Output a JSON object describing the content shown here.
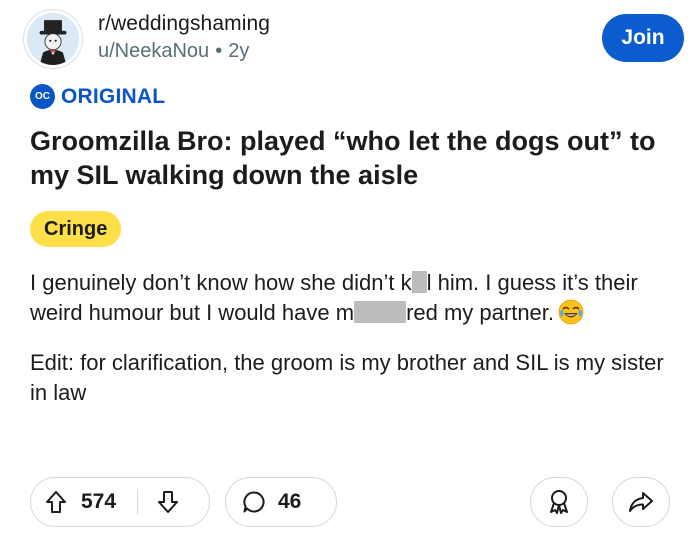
{
  "post": {
    "subreddit": "r/weddingshaming",
    "author": "u/NeekaNou",
    "separator": "•",
    "age": "2y",
    "join_label": "Join",
    "oc_badge": "OC",
    "oc_label": "ORIGINAL",
    "title": "Groomzilla Bro: played “who let the dogs out” to my SIL walking down the aisle",
    "flair": "Cringe",
    "body": {
      "p1_a": "I genuinely don’t know how she didn’t k",
      "p1_b": "l him. I guess it’s their weird humour but I would have m",
      "p1_c": "red my partner.",
      "p2": "Edit: for clarification, the groom is my brother and SIL is my sister in law"
    },
    "upvotes": "574",
    "comments": "46"
  },
  "colors": {
    "join_button": "#0a5ccf",
    "oc_blue": "#0c55c6",
    "flair_yellow": "#fcdf49",
    "meta_gray": "#576f76",
    "border": "#d5d8da"
  },
  "icons": {
    "avatar": "subreddit-avatar-icon",
    "upvote": "upvote-arrow-icon",
    "downvote": "downvote-arrow-icon",
    "comment": "comment-bubble-icon",
    "award": "award-ribbon-icon",
    "share": "share-arrow-icon",
    "emoji": "tears-of-joy-emoji"
  }
}
